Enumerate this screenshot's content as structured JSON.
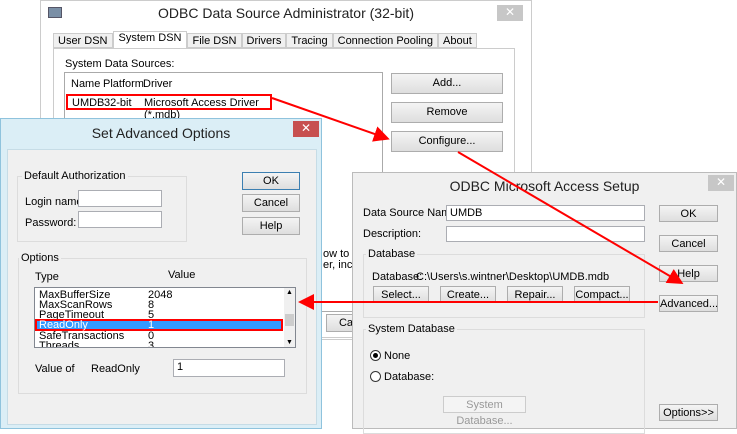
{
  "main_window": {
    "title": "ODBC Data Source Administrator (32-bit)",
    "tabs": [
      "User DSN",
      "System DSN",
      "File DSN",
      "Drivers",
      "Tracing",
      "Connection Pooling",
      "About"
    ],
    "active_tab": "System DSN",
    "section_label": "System Data Sources:",
    "columns": [
      "Name",
      "Platform",
      "Driver"
    ],
    "rows": [
      {
        "name": "UMDB",
        "platform": "32-bit",
        "driver": "Microsoft Access Driver (*.mdb)"
      }
    ],
    "buttons": {
      "add": "Add...",
      "remove": "Remove",
      "configure": "Configure..."
    },
    "partial_text": [
      "ow to co",
      "er, inclu"
    ],
    "partial_button": "Ca"
  },
  "advanced": {
    "title": "Set Advanced Options",
    "close": "✕",
    "auth_group": "Default Authorization",
    "login_label": "Login name:",
    "login_value": "",
    "password_label": "Password:",
    "password_value": "",
    "buttons": {
      "ok": "OK",
      "cancel": "Cancel",
      "help": "Help"
    },
    "options_group": "Options",
    "type_header": "Type",
    "value_header": "Value",
    "options": [
      {
        "type": "MaxBufferSize",
        "value": "2048"
      },
      {
        "type": "MaxScanRows",
        "value": "8"
      },
      {
        "type": "PageTimeout",
        "value": "5"
      },
      {
        "type": "ReadOnly",
        "value": "1",
        "selected": true
      },
      {
        "type": "SafeTransactions",
        "value": "0"
      },
      {
        "type": "Threads",
        "value": "3"
      }
    ],
    "value_of_label": "Value of",
    "value_of_name": "ReadOnly",
    "value_of_value": "1"
  },
  "access_setup": {
    "title": "ODBC Microsoft Access Setup",
    "close": "✕",
    "dsn_label": "Data Source Name:",
    "dsn_value": "UMDB",
    "desc_label": "Description:",
    "desc_value": "",
    "database_group": "Database",
    "database_label": "Database:",
    "database_path": "C:\\Users\\s.wintner\\Desktop\\UMDB.mdb",
    "db_buttons": {
      "select": "Select...",
      "create": "Create...",
      "repair": "Repair...",
      "compact": "Compact..."
    },
    "side_buttons": {
      "ok": "OK",
      "cancel": "Cancel",
      "help": "Help",
      "advanced": "Advanced...",
      "options": "Options>>"
    },
    "sysdb_group": "System Database",
    "radio_none": "None",
    "radio_database": "Database:",
    "radio_selected": "None",
    "sysdb_button": "System Database..."
  },
  "colors": {
    "annotation_red": "#ff0000",
    "selection_blue": "#3399ff",
    "close_red": "#c75050"
  }
}
